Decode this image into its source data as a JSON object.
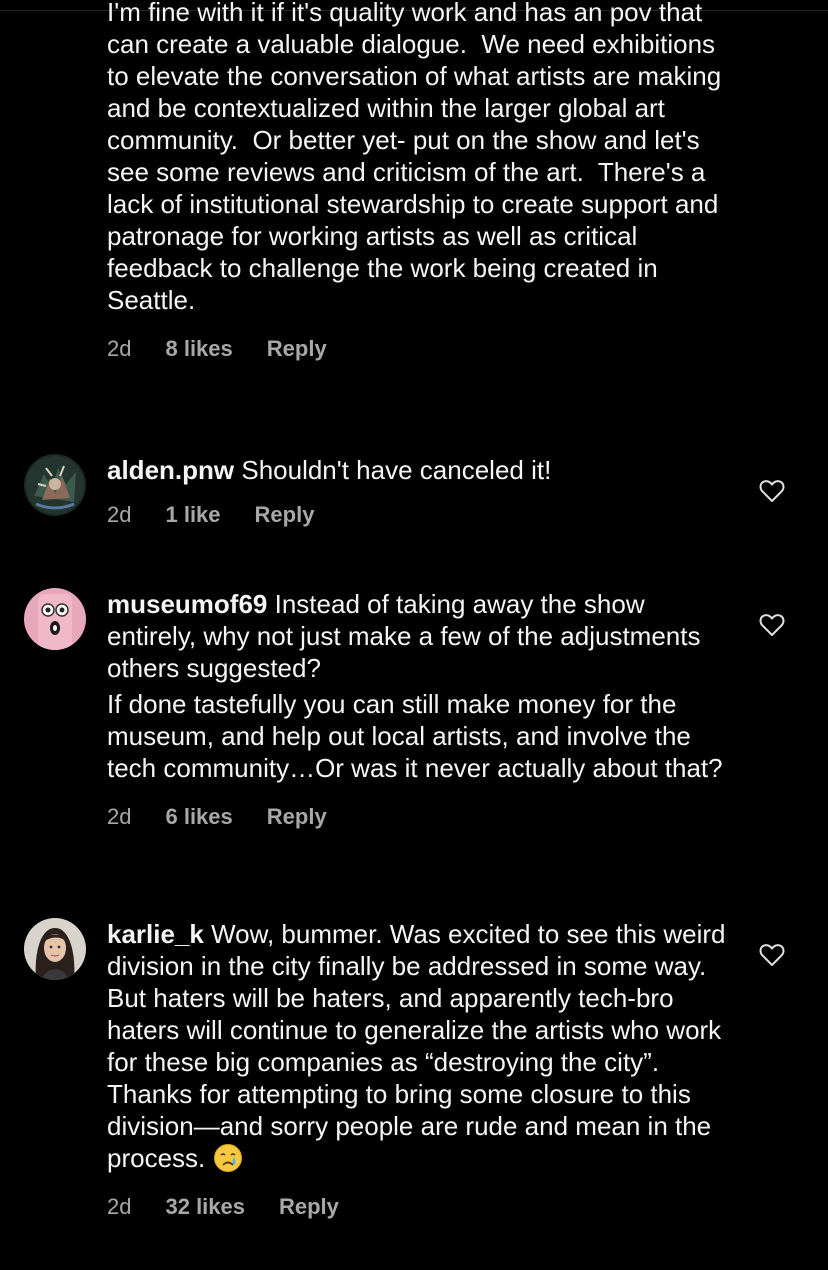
{
  "comments": [
    {
      "username": "",
      "text_p1": "I'm fine with it if it's quality work and has an pov that can create a valuable dialogue.  We need exhibitions to elevate the conversation of what artists are making and be contextualized within the larger global art community.  Or better yet- put on the show and let's see some reviews and criticism of the art.  There's a lack of institutional stewardship to create support and patronage for working artists as well as critical feedback to challenge the work being created in Seattle.",
      "time": "2d",
      "likes": "8 likes",
      "reply": "Reply"
    },
    {
      "username": "alden.pnw",
      "text_p1": " Shouldn't have canceled it!",
      "time": "2d",
      "likes": "1 like",
      "reply": "Reply"
    },
    {
      "username": "museumof69",
      "text_p1": " Instead of taking away the show entirely, why not just make a few of the adjustments others suggested?",
      "text_p2": "If done tastefully you can still make money for the museum, and help out local artists, and involve the tech community…Or was it never actually about that?",
      "time": "2d",
      "likes": "6 likes",
      "reply": "Reply"
    },
    {
      "username": "karlie_k",
      "text_p1": " Wow, bummer. Was excited to see this weird division in the city finally be addressed in some way. But haters will be haters, and apparently tech-bro haters will continue to generalize the artists who work for these big companies as “destroying the city”. Thanks for attempting to bring some closure to this division—and sorry people are rude and mean in the process. ",
      "time": "2d",
      "likes": "32 likes",
      "reply": "Reply"
    }
  ],
  "icons": {
    "like": "heart-outline-icon",
    "emoji": "crying-face-emoji"
  },
  "colors": {
    "background": "#000000",
    "text": "#f5f5f5",
    "meta": "#a8a8a8"
  }
}
